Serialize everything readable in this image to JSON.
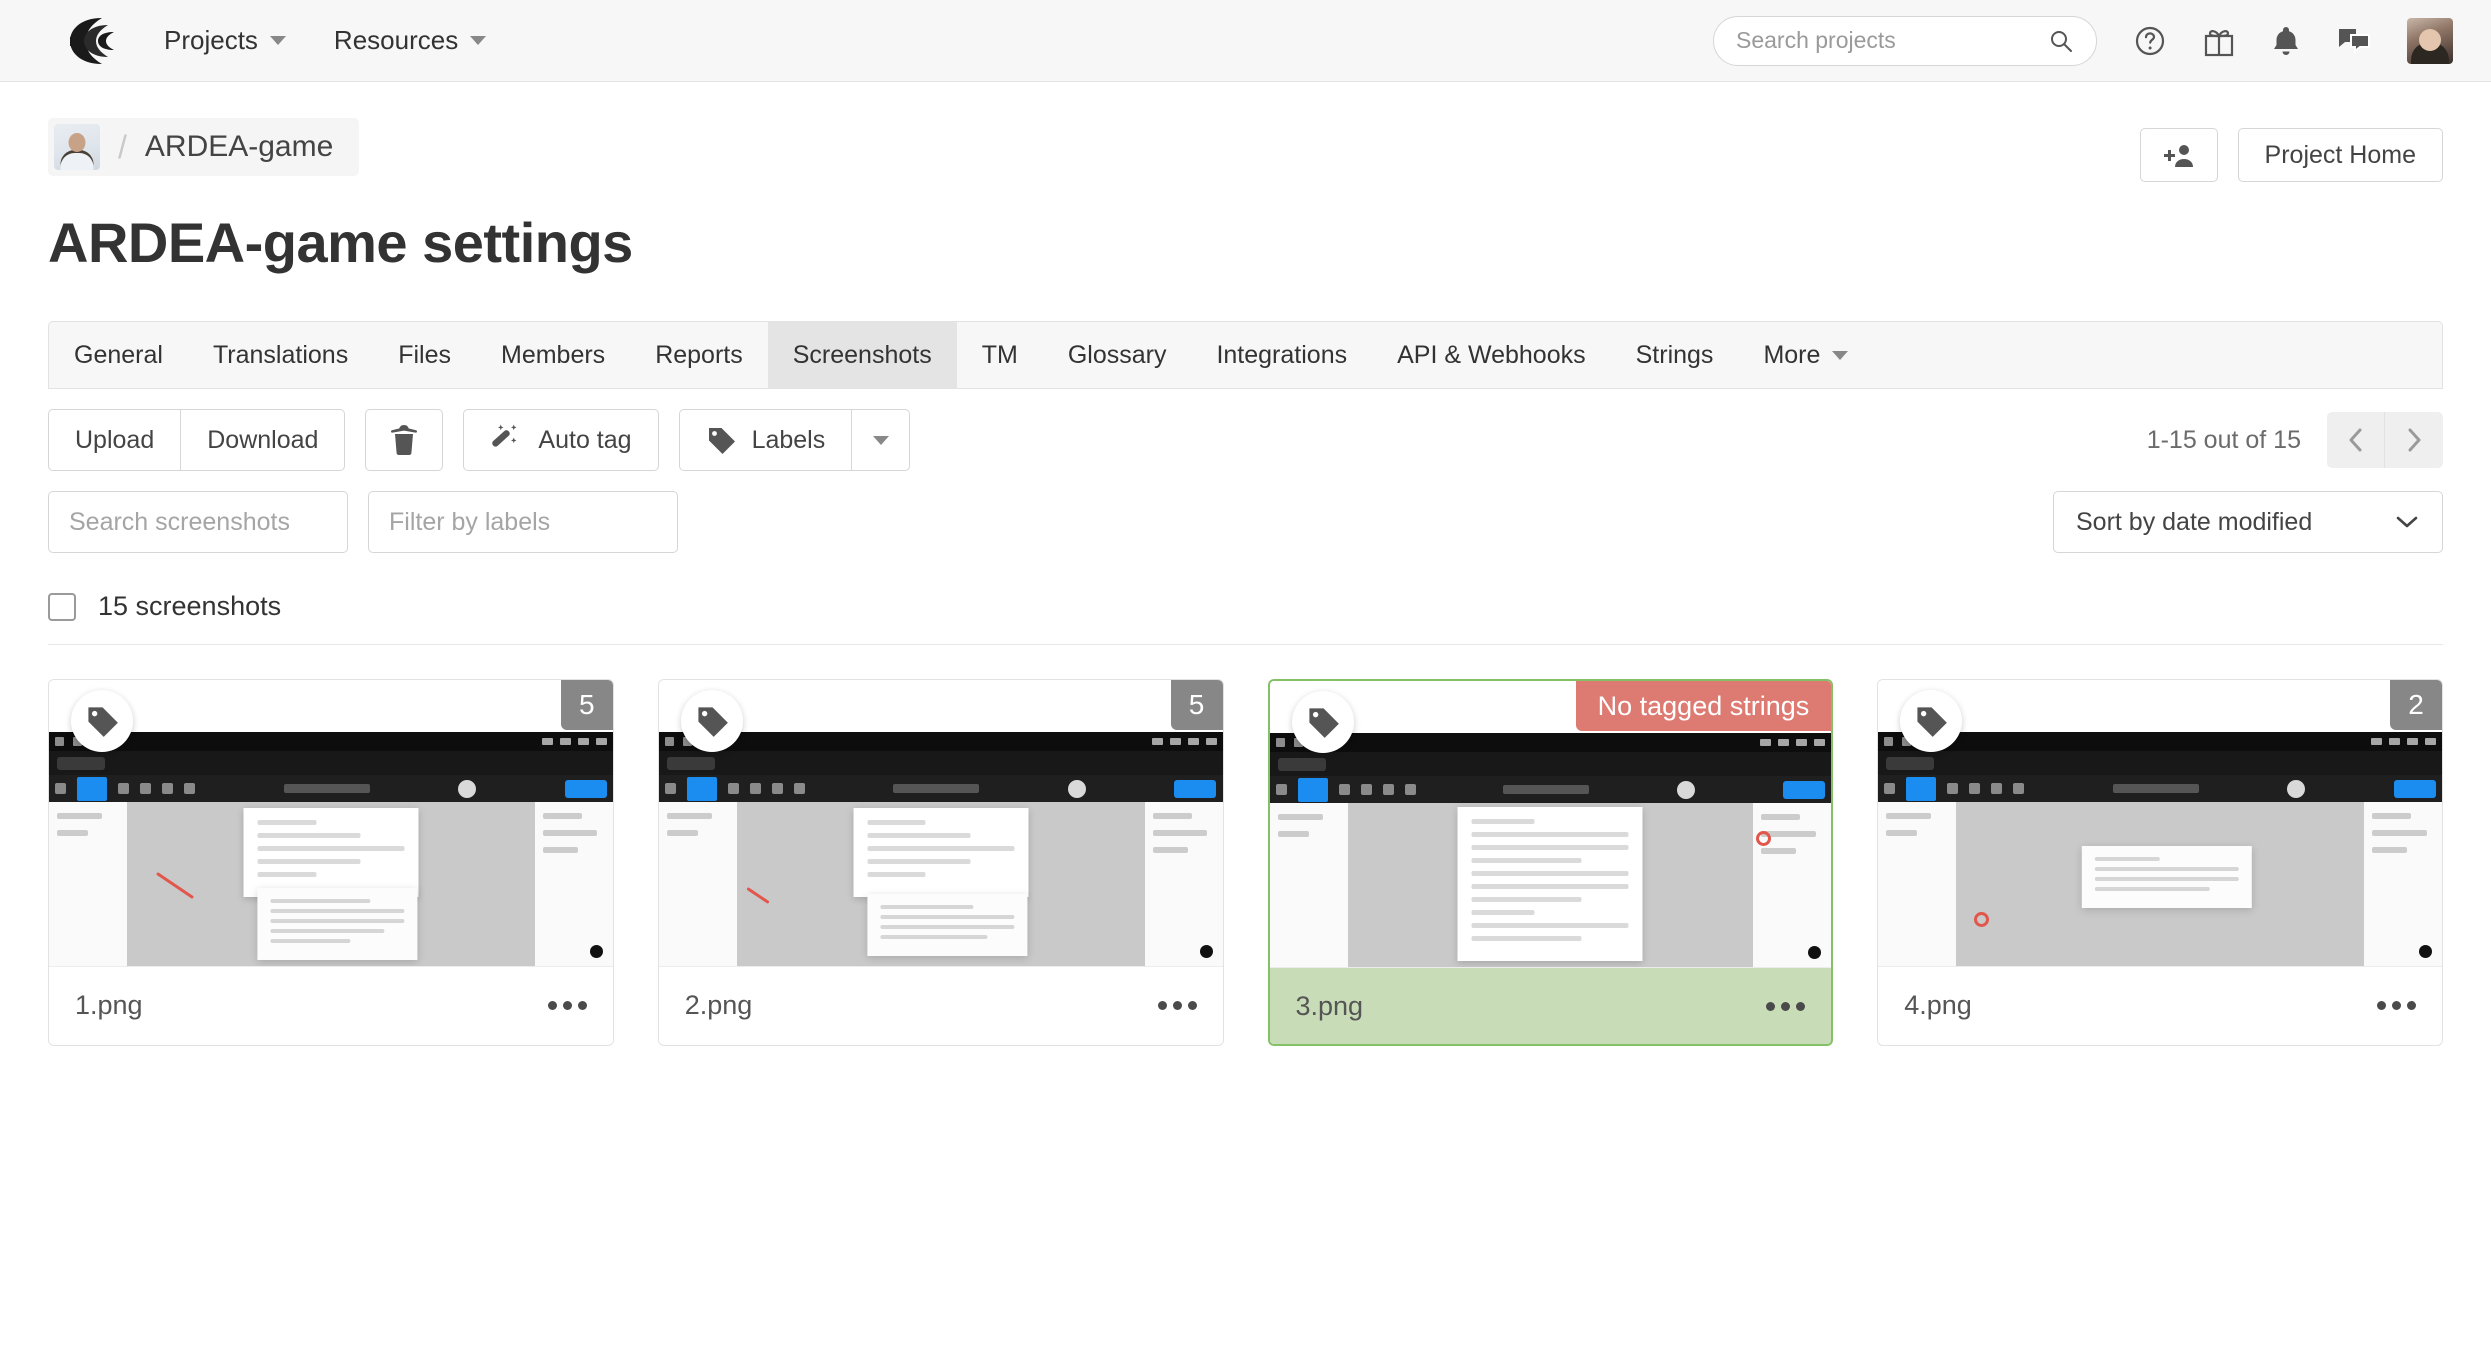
{
  "topnav": {
    "logo_icon": "crowdin-logo-icon",
    "links": [
      {
        "label": "Projects",
        "icon": "chevron-down-icon"
      },
      {
        "label": "Resources",
        "icon": "chevron-down-icon"
      }
    ],
    "search": {
      "placeholder": "Search projects",
      "value": "",
      "icon": "search-icon"
    },
    "icons": [
      "help-icon",
      "gift-icon",
      "bell-icon",
      "chat-icon"
    ],
    "avatar": "user-avatar"
  },
  "breadcrumb": {
    "avatar": "owner-avatar",
    "separator": "/",
    "project": "ARDEA-game"
  },
  "header": {
    "title": "ARDEA-game settings",
    "add_member_label": "",
    "add_member_icon": "add-user-icon",
    "project_home_label": "Project Home"
  },
  "tabs": [
    {
      "label": "General",
      "active": false
    },
    {
      "label": "Translations",
      "active": false
    },
    {
      "label": "Files",
      "active": false
    },
    {
      "label": "Members",
      "active": false
    },
    {
      "label": "Reports",
      "active": false
    },
    {
      "label": "Screenshots",
      "active": true
    },
    {
      "label": "TM",
      "active": false
    },
    {
      "label": "Glossary",
      "active": false
    },
    {
      "label": "Integrations",
      "active": false
    },
    {
      "label": "API & Webhooks",
      "active": false
    },
    {
      "label": "Strings",
      "active": false
    },
    {
      "label": "More",
      "active": false,
      "caret": true
    }
  ],
  "toolbar": {
    "upload_label": "Upload",
    "download_label": "Download",
    "delete_icon": "trash-icon",
    "autotag_label": "Auto tag",
    "autotag_icon": "magic-wand-icon",
    "labels_label": "Labels",
    "labels_icon": "tag-icon",
    "labels_caret_icon": "caret-down-icon",
    "pagination_text": "1-15 out of 15",
    "prev_icon": "chevron-left-icon",
    "next_icon": "chevron-right-icon"
  },
  "filters": {
    "search_placeholder": "Search screenshots",
    "search_value": "",
    "search_help_icon": "question-mark-icon",
    "labels_placeholder": "Filter by labels",
    "labels_value": "",
    "sort_value": "Sort by date modified",
    "sort_caret_icon": "chevron-down-icon"
  },
  "select_all": {
    "checked": false,
    "label": "15 screenshots"
  },
  "colors": {
    "selected_border": "#84c065",
    "selected_footer": "#c8ddb7",
    "count_badge": "#878787",
    "warning_badge": "#dd7b72",
    "accent_blue": "#1b8cf0"
  },
  "cards": [
    {
      "name": "1.png",
      "badge": "5",
      "badge_type": "count",
      "selected": false,
      "tag_icon": "tag-icon",
      "menu_icon": "more-options-icon"
    },
    {
      "name": "2.png",
      "badge": "5",
      "badge_type": "count",
      "selected": false,
      "tag_icon": "tag-icon",
      "menu_icon": "more-options-icon"
    },
    {
      "name": "3.png",
      "badge": "No tagged strings",
      "badge_type": "warning",
      "selected": true,
      "tag_icon": "tag-icon",
      "menu_icon": "more-options-icon"
    },
    {
      "name": "4.png",
      "badge": "2",
      "badge_type": "count",
      "selected": false,
      "tag_icon": "tag-icon",
      "menu_icon": "more-options-icon"
    }
  ]
}
